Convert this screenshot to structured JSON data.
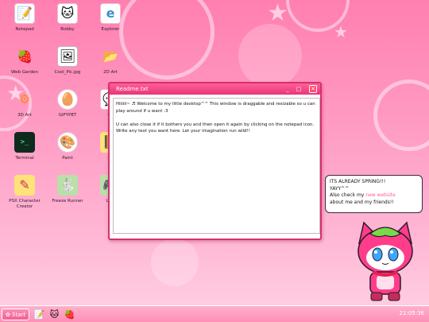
{
  "desktop_icons": [
    {
      "label": "Notepad",
      "glyph": "📝",
      "bg": "#ffffff",
      "icon": "notepad-icon"
    },
    {
      "label": "Bobby",
      "glyph": "🐱",
      "bg": "#ffffff",
      "icon": "cat-face-icon"
    },
    {
      "label": "Explorer",
      "glyph": "e",
      "bg": "#ffffff",
      "icon": "browser-e-icon"
    },
    {
      "label": "Web Garden",
      "glyph": "🍓",
      "bg": "transparent",
      "icon": "strawberry-icon"
    },
    {
      "label": "Cool_Pic.jpg",
      "glyph": "🖼",
      "bg": "#ffffff",
      "icon": "image-file-icon"
    },
    {
      "label": "2D Art",
      "glyph": "📂",
      "bg": "transparent",
      "icon": "folder-icon"
    },
    {
      "label": "3D Art",
      "glyph": "⚙",
      "bg": "transparent",
      "icon": "blender-icon"
    },
    {
      "label": "GIFYPET",
      "glyph": "🥚",
      "bg": "#ffffff",
      "icon": "tamagotchi-icon"
    },
    {
      "label": "Ch",
      "glyph": "💬",
      "bg": "#ffffff",
      "icon": "chat-icon"
    },
    {
      "label": "Terminal",
      "glyph": ">_",
      "bg": "#0e2b1d",
      "icon": "terminal-icon"
    },
    {
      "label": "Paint",
      "glyph": "🎨",
      "bg": "#ffffff",
      "icon": "paint-palette-icon"
    },
    {
      "label": "Bo",
      "glyph": "📙",
      "bg": "#ffe27a",
      "icon": "book-icon"
    },
    {
      "label": "PSX Character Creator",
      "glyph": "✎",
      "bg": "#ffe27a",
      "icon": "character-creator-icon"
    },
    {
      "label": "Freeze Runner",
      "glyph": "🐇",
      "bg": "#b8e0a8",
      "icon": "game-bunny-icon"
    },
    {
      "label": "Littl",
      "glyph": "🎮",
      "bg": "#b8e0a8",
      "icon": "game-icon"
    }
  ],
  "window": {
    "title": "Readme.txt",
    "minimize": "_",
    "maximize": "□",
    "close": "✕",
    "content": "Hiiiiii~ ♬ Welcome to my little desktop^^ This window is draggable and resizable so u can play around if u want :3\n\nU can also close it if it bothers you and then open it again by clicking on the notepad icon. Write any text you want here. Let your imagination run wild!!"
  },
  "bubble": {
    "line1": "ITS ALREADY SPRING!!!",
    "line2": "YAYY^^",
    "line3_pre": "Also check my ",
    "link": "new website",
    "line4": "about me and my friends!!"
  },
  "taskbar": {
    "start_label": "Start",
    "clock": "21:05:36",
    "start_glyph": "✿",
    "pinned": [
      "📝",
      "🐱",
      "🍓"
    ]
  },
  "colors": {
    "accent": "#e8367a",
    "link": "#ff5c9b"
  }
}
